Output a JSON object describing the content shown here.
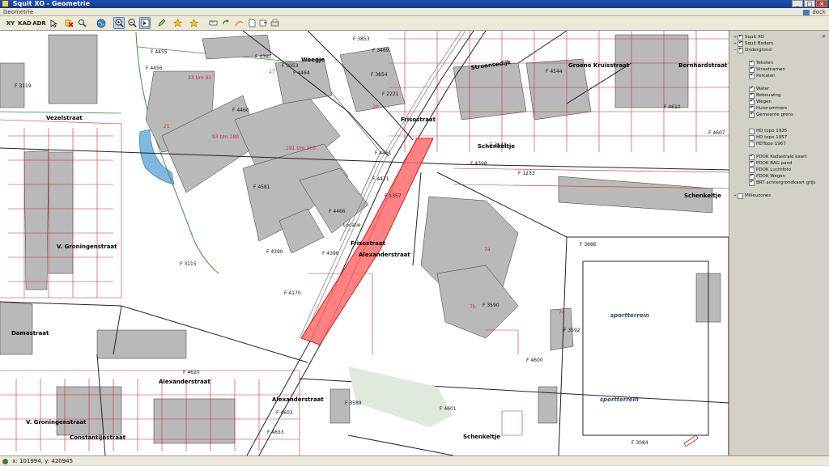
{
  "window": {
    "title": "Squit XO - Geometrie",
    "minimize": "_",
    "maximize": "□",
    "close": "×"
  },
  "subbar": {
    "label": "Geometrie",
    "dock_label": "dock"
  },
  "toolbar": {
    "xy": "XY",
    "kad": "KAD",
    "adr": "ADR",
    "tools": [
      "pointer-icon",
      "delete-icon",
      "search-icon",
      "globe-icon",
      "zoom-in-icon",
      "zoom-out-icon",
      "identify-icon",
      "edit-icon",
      "star-icon",
      "star-add-icon",
      "measure-icon",
      "redo-icon",
      "route-icon",
      "document-icon",
      "export-icon",
      "print-icon",
      "settings-icon"
    ]
  },
  "layers": [
    {
      "label": "Squit XO",
      "checked": true,
      "level": 0,
      "expander": "+"
    },
    {
      "label": "Squit Bodem",
      "checked": true,
      "level": 0,
      "expander": "+"
    },
    {
      "label": "Ondergrond",
      "checked": true,
      "level": 0,
      "expander": "−"
    },
    {
      "label": "Teksten",
      "checked": true,
      "level": 1,
      "expander": ""
    },
    {
      "label": "Straatnamen",
      "checked": true,
      "level": 1,
      "expander": ""
    },
    {
      "label": "Percelen",
      "checked": true,
      "level": 1,
      "expander": ""
    },
    {
      "label": "Water",
      "checked": true,
      "level": 1,
      "expander": ""
    },
    {
      "label": "Bebouwing",
      "checked": true,
      "level": 1,
      "expander": ""
    },
    {
      "label": "Wegen",
      "checked": true,
      "level": 1,
      "expander": ""
    },
    {
      "label": "Huisnummers",
      "checked": true,
      "level": 1,
      "expander": ""
    },
    {
      "label": "Gemeente grens",
      "checked": true,
      "level": 1,
      "expander": ""
    },
    {
      "label": "HD topo 1925",
      "checked": false,
      "level": 1,
      "expander": ""
    },
    {
      "label": "HD topo 1957",
      "checked": false,
      "level": 1,
      "expander": ""
    },
    {
      "label": "HDTopo 1967",
      "checked": false,
      "level": 1,
      "expander": ""
    },
    {
      "label": "PDOK Kadastrale kaart",
      "checked": true,
      "level": 1,
      "expander": ""
    },
    {
      "label": "PDOK BAG pand",
      "checked": true,
      "level": 1,
      "expander": ""
    },
    {
      "label": "PDOK Luchtfoto",
      "checked": false,
      "level": 1,
      "expander": ""
    },
    {
      "label": "PDOK Wegen",
      "checked": true,
      "level": 1,
      "expander": ""
    },
    {
      "label": "BRT achtergrondkaart grijs",
      "checked": true,
      "level": 1,
      "expander": ""
    },
    {
      "label": "Milieuzones",
      "checked": false,
      "level": 0,
      "expander": "+"
    }
  ],
  "map": {
    "streets": [
      "Weegje",
      "Stroensedijk",
      "Groene Kruisstraat",
      "Bernhardstraat",
      "Vezelstraat",
      "Frisostraat",
      "Schenkeltje",
      "Schenkeltje",
      "Schenkeltje",
      "V. Groningenstraat",
      "Frisostraat",
      "Alexanderstraat",
      "Damastraat",
      "Alexanderstraat",
      "Alexanderstraat",
      "V. Groningenstraat",
      "Constantijnstraat"
    ],
    "parcels": [
      "F 4455",
      "F 4456",
      "F 3853",
      "F 3469",
      "F 4381",
      "F 3053",
      "F 4464",
      "F 3854",
      "F 4544",
      "F 2221",
      "F 4460",
      "F 4610",
      "F 4607",
      "F 3141",
      "F 1233",
      "F 4398",
      "F 4461",
      "F 4466",
      "F 1357",
      "F 3115",
      "F 3119",
      "F 4581",
      "F 4390",
      "F 4396",
      "F 4170",
      "F 4620",
      "F 4603",
      "F 4653",
      "F 3589",
      "F 4601",
      "F 3590",
      "F 4600",
      "F 3592",
      "F 3084",
      "F 3886",
      "F 4471"
    ],
    "house_numbers": [
      "23 t/m 91",
      "93 t/m 189",
      "191 t/m 263",
      "7a",
      "7b",
      "7c",
      "21",
      "20",
      "17"
    ],
    "labels": {
      "sportterrein_1": "sportterrein",
      "sportterrein_2": "sportterrein",
      "selected_label": "Locatie"
    },
    "colors": {
      "parcel_line": "#d42a2a",
      "building": "#b9b9b9",
      "road": "#222222",
      "green": "#3f8d3f",
      "water": "#7fb9df",
      "selection": "#ff6b6b"
    }
  },
  "status": {
    "coords": "x: 101994, y: 420945"
  }
}
